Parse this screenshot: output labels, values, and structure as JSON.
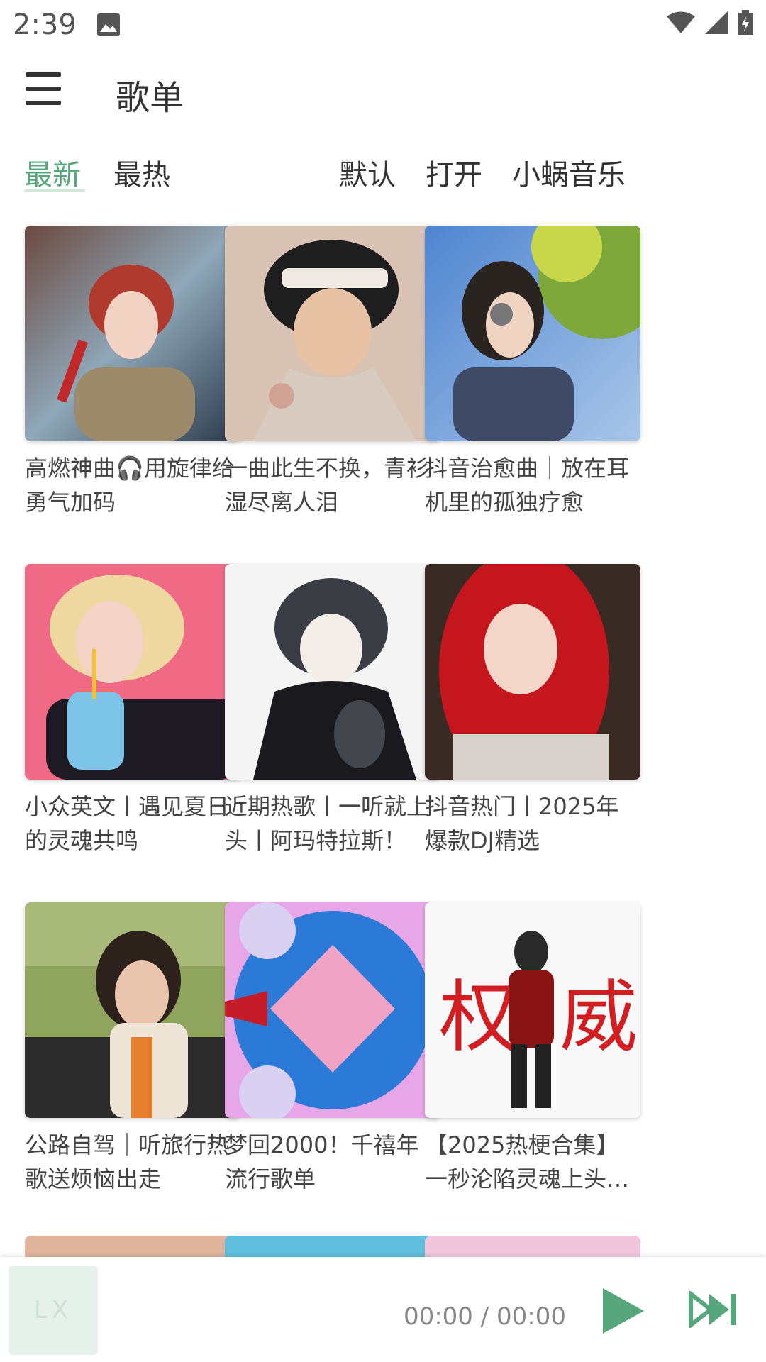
{
  "status": {
    "time": "2:39"
  },
  "app": {
    "title": "歌单"
  },
  "tabs": {
    "sort": [
      "最新",
      "最热"
    ],
    "actions": [
      "默认",
      "打开",
      "小蜗音乐"
    ]
  },
  "playlists": [
    {
      "title": "高燃神曲🎧用旋律给勇气加码"
    },
    {
      "title": "一曲此生不换，青衫湿尽离人泪"
    },
    {
      "title": "抖音治愈曲｜放在耳机里的孤独疗愈"
    },
    {
      "title": "小众英文丨遇见夏日的灵魂共鸣"
    },
    {
      "title": "近期热歌丨一听就上头丨阿玛特拉斯！"
    },
    {
      "title": "抖音热门丨2025年爆款DJ精选"
    },
    {
      "title": "公路自驾｜听旅行热歌送烦恼出走"
    },
    {
      "title": "梦回2000！千禧年流行歌单"
    },
    {
      "title": "【2025热梗合集】一秒沦陷灵魂上头…"
    }
  ],
  "player": {
    "cover_text": "LX",
    "time": "00:00 / 00:00",
    "accent": "#56a87c"
  },
  "colors": {
    "accent": "#56a87c"
  }
}
